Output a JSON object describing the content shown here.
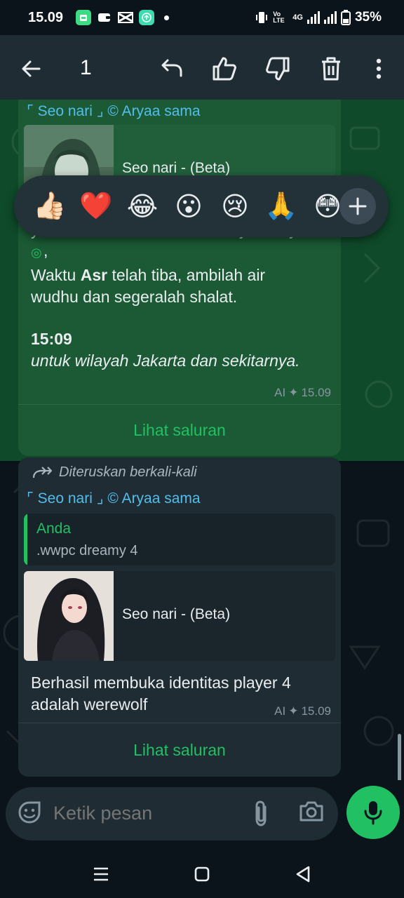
{
  "status_bar": {
    "time": "15.09",
    "network": "4G",
    "battery": "35%",
    "volte": "Vo LTE"
  },
  "app_bar": {
    "selected_count": "1",
    "icons": [
      "back-arrow-icon",
      "reply-icon",
      "thumbs-up-icon",
      "thumbs-down-icon",
      "trash-icon",
      "more-vert-icon"
    ]
  },
  "reactions": {
    "items": [
      "👍🏻",
      "❤️",
      "😂",
      "😮",
      "😢",
      "🙏",
      "😳"
    ],
    "more_icon": "plus-icon"
  },
  "messages": [
    {
      "channel": "⌜ Seo nari ⌟ © Aryaa sama",
      "preview_title": "Seo nari - (Beta)",
      "partial_line": "yahoo onichan, ncechan @c.y.i.l o.r.y",
      "line_a": "Waktu ",
      "line_a_bold": "Asr",
      "line_a_rest": " telah tiba, ambilah air",
      "line_b": "wudhu dan segeralah shalat.",
      "time_bold": "15:09",
      "region": "untuk wilayah Jakarta dan sekitarnya.",
      "meta_ai": "AI",
      "meta_time": "15.09",
      "button": "Lihat saluran",
      "selected": true
    },
    {
      "forwarded": "Diteruskan berkali-kali",
      "channel": "⌜ Seo nari ⌟ © Aryaa sama",
      "quote_name": "Anda",
      "quote_text": ".wwpc dreamy 4",
      "preview_title": "Seo nari - (Beta)",
      "line_a": "Berhasil membuka identitas player 4",
      "line_b": "adalah werewolf",
      "meta_ai": "AI",
      "meta_time": "15.09",
      "button": "Lihat saluran",
      "selected": false
    }
  ],
  "composer": {
    "placeholder": "Ketik pesan"
  },
  "colors": {
    "accent": "#21c063",
    "link": "#53bdeb",
    "selected_bg": "#0f4a2a"
  }
}
